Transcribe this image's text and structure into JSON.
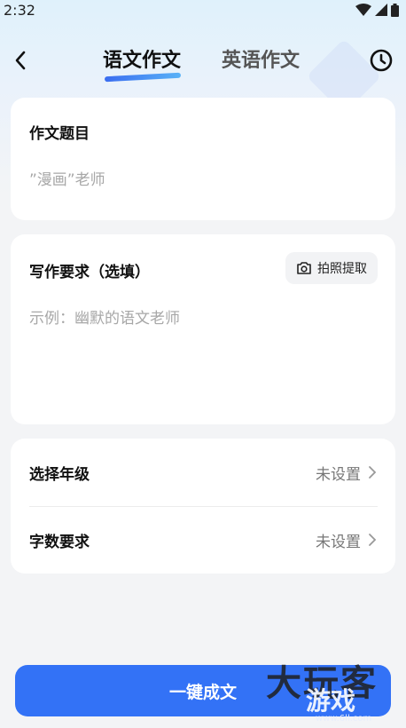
{
  "status": {
    "time": "2:32"
  },
  "header": {
    "tabs": [
      {
        "label": "语文作文",
        "active": true
      },
      {
        "label": "英语作文",
        "active": false
      }
    ],
    "back_icon": "chevron-left-icon",
    "history_icon": "clock-icon"
  },
  "title_card": {
    "label": "作文题目",
    "placeholder": "”漫画”老师"
  },
  "requirements_card": {
    "label": "写作要求（选填）",
    "placeholder": "示例：幽默的语文老师",
    "photo_button": "拍照提取"
  },
  "settings": [
    {
      "label": "选择年级",
      "value": "未设置"
    },
    {
      "label": "字数要求",
      "value": "未设置"
    }
  ],
  "submit_label": "一键成文",
  "watermark": {
    "main": "大玩客",
    "sub": "游戏",
    "url": "www.6ll.com"
  },
  "colors": {
    "accent": "#3372f6",
    "page_bg": "#f3f4f6"
  }
}
